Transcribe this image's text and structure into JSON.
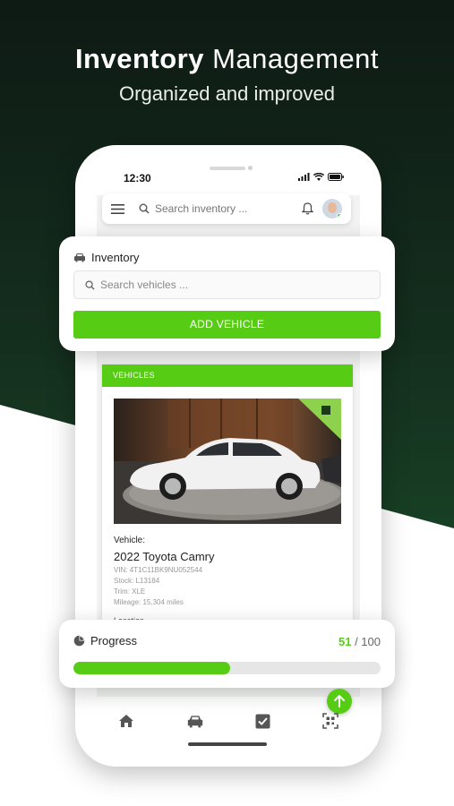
{
  "promo": {
    "headline_bold": "Inventory",
    "headline_light": "Management",
    "subheadline": "Organized and improved"
  },
  "status_bar": {
    "time": "12:30"
  },
  "app_bar": {
    "search_placeholder": "Search inventory ..."
  },
  "inventory": {
    "title": "Inventory",
    "search_placeholder": "Search vehicles ...",
    "add_button": "ADD VEHICLE"
  },
  "vehicles": {
    "header": "VEHICLES",
    "label": "Vehicle:",
    "name": "2022 Toyota Camry",
    "vin": "VIN: 4T1C11BK9NU052544",
    "stock": "Stock: L13184",
    "trim": "Trim: XLE",
    "mileage": "Mileage: 15,304 miles",
    "location_label": "Location"
  },
  "progress": {
    "title": "Progress",
    "done": "51",
    "separator": " / ",
    "total": "100",
    "fraction": 0.51
  },
  "nav": {
    "items": [
      "home-icon",
      "car-icon",
      "checklist-icon",
      "qr-scan-icon"
    ]
  },
  "colors": {
    "accent": "#57cc14",
    "dark_bg": "#15301f"
  }
}
